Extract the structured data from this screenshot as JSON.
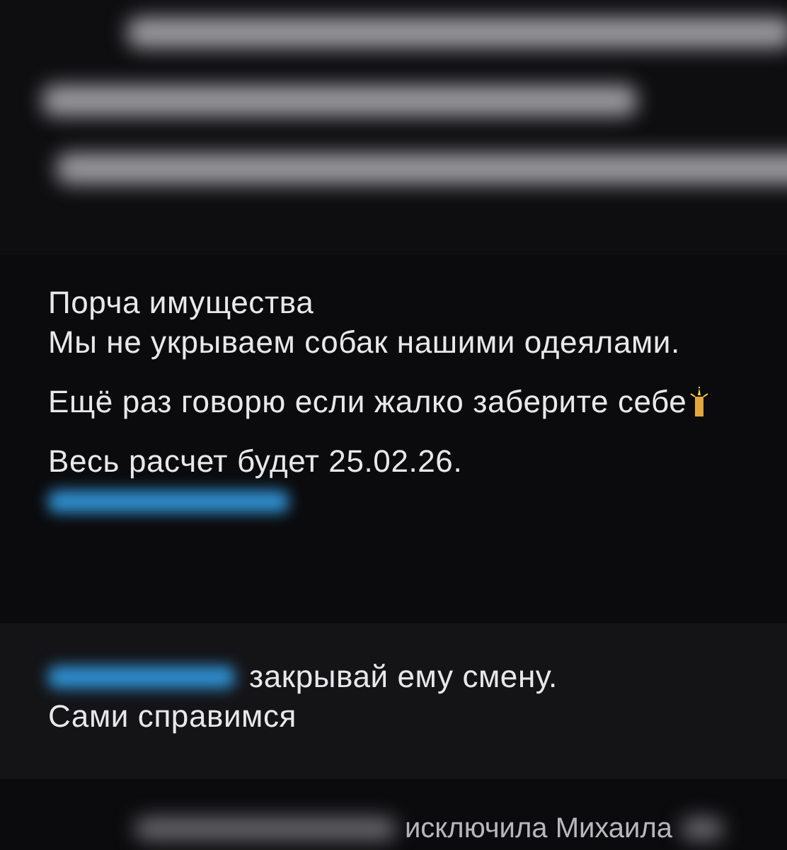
{
  "messages": [
    {
      "lines": [
        {
          "kind": "line",
          "text": "Порча имущества"
        },
        {
          "kind": "line",
          "text": "Мы не укрываем собак нашими одеялами."
        },
        {
          "kind": "paragraph_candle",
          "text": "Ещё раз говорю если жалко заберите себе"
        },
        {
          "kind": "paragraph",
          "text": "Весь расчет будет 25.02.26."
        },
        {
          "kind": "mention"
        }
      ]
    },
    {
      "lines": [
        {
          "kind": "mention_line",
          "text": "закрывай ему смену."
        },
        {
          "kind": "line",
          "text": "Сами справимся"
        }
      ]
    }
  ],
  "service_message": {
    "text": "исключила Михаила"
  }
}
